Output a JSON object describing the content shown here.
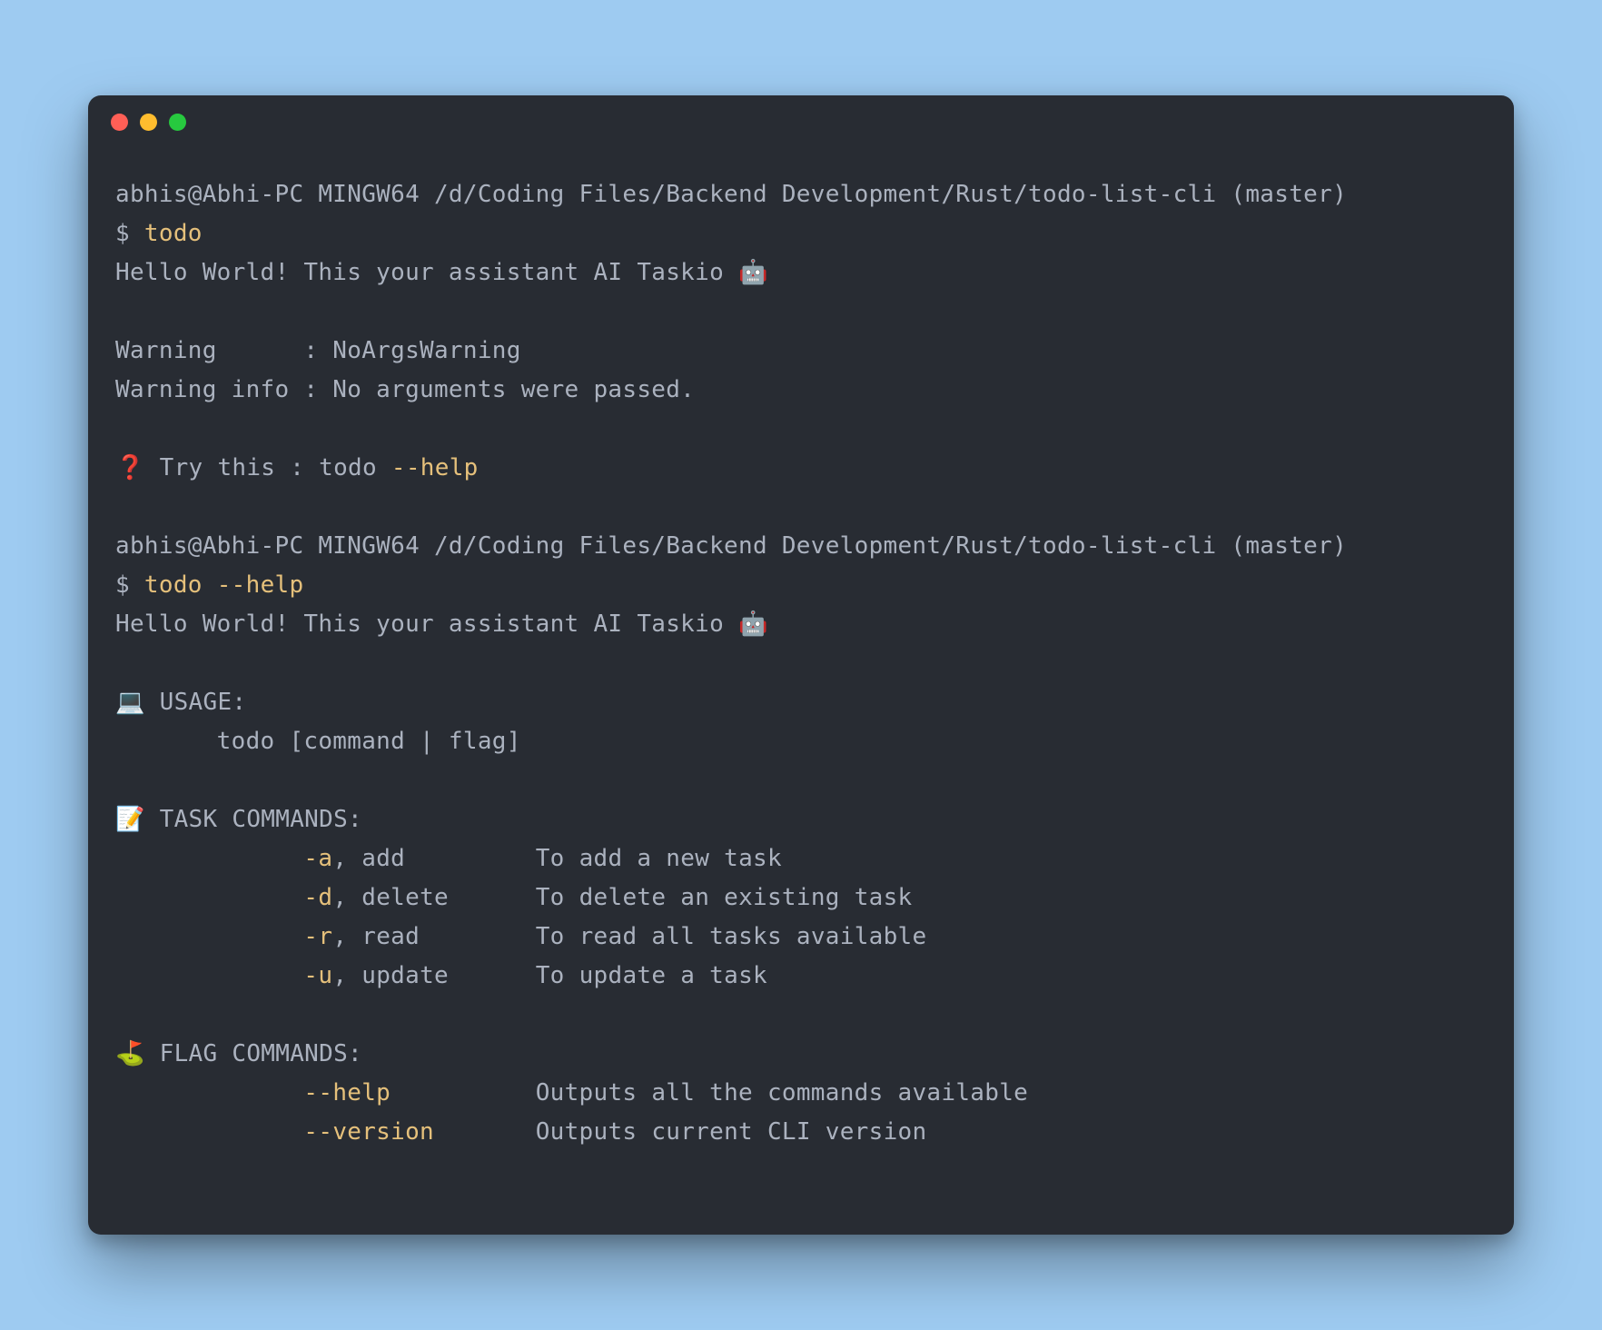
{
  "prompt1": "abhis@Abhi-PC MINGW64 /d/Coding Files/Backend Development/Rust/todo-list-cli (master)",
  "cmd1_prefix": "$ ",
  "cmd1": "todo",
  "greeting": "Hello World! This your assistant AI Taskio 🤖",
  "warning_line": "Warning      : NoArgsWarning",
  "warning_info": "Warning info : No arguments were passed.",
  "try_prefix": "❓ Try this : todo ",
  "try_flag": "--help",
  "prompt2": "abhis@Abhi-PC MINGW64 /d/Coding Files/Backend Development/Rust/todo-list-cli (master)",
  "cmd2_prefix": "$ ",
  "cmd2": "todo ",
  "cmd2_flag": "--help",
  "greeting2": "Hello World! This your assistant AI Taskio 🤖",
  "usage_header": "💻 USAGE:",
  "usage_line": "       todo [command | flag]",
  "task_header": "📝 TASK COMMANDS:",
  "task_commands": [
    {
      "flag": "-a",
      "sep": ", ",
      "name": "add",
      "desc": "To add a new task"
    },
    {
      "flag": "-d",
      "sep": ", ",
      "name": "delete",
      "desc": "To delete an existing task"
    },
    {
      "flag": "-r",
      "sep": ", ",
      "name": "read",
      "desc": "To read all tasks available"
    },
    {
      "flag": "-u",
      "sep": ", ",
      "name": "update",
      "desc": "To update a task"
    }
  ],
  "flag_header": "⛳ FLAG COMMANDS:",
  "flag_commands": [
    {
      "flag": "--help",
      "desc": "Outputs all the commands available"
    },
    {
      "flag": "--version",
      "desc": "Outputs current CLI version"
    }
  ]
}
